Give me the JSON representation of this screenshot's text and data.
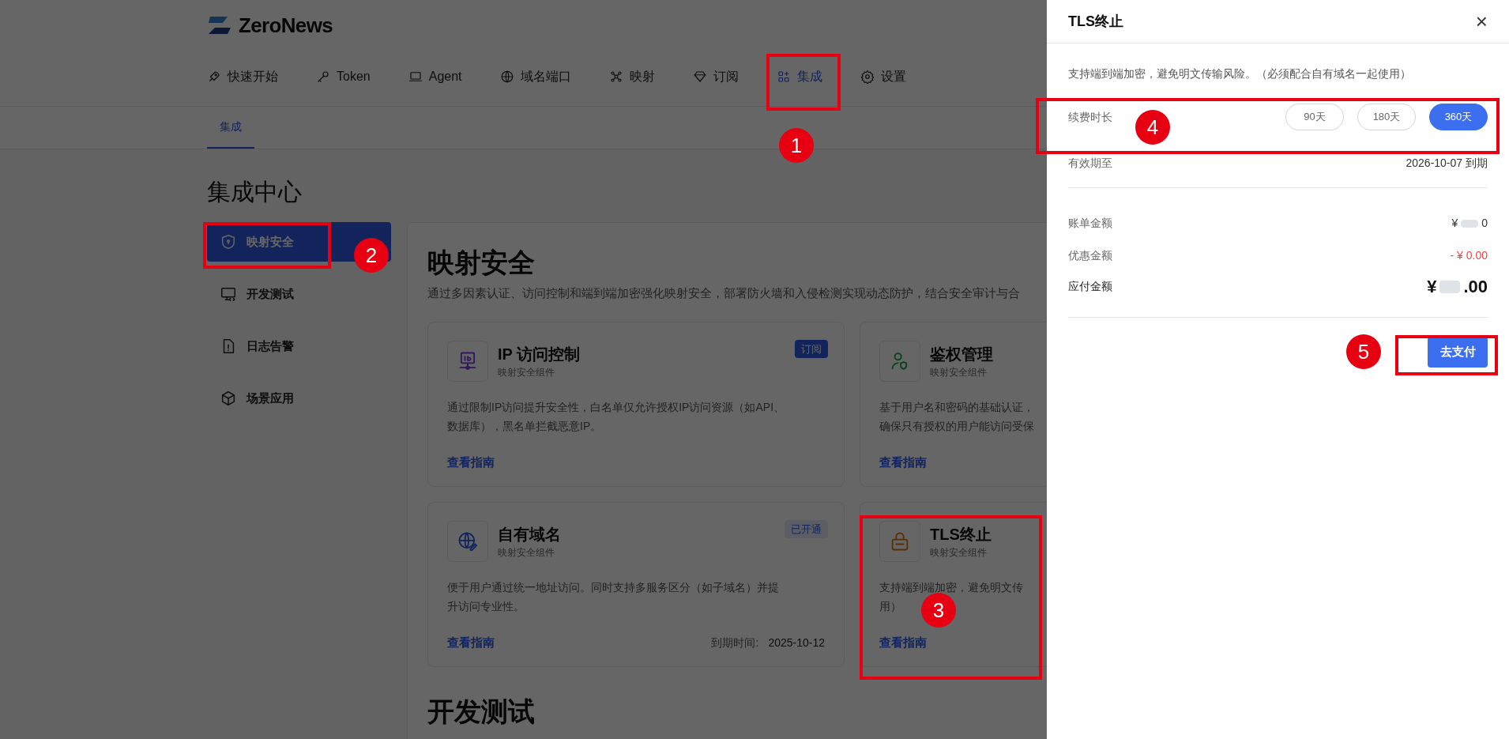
{
  "brand": {
    "name": "ZeroNews"
  },
  "nav": [
    {
      "label": "快速开始",
      "selected": false
    },
    {
      "label": "Token",
      "selected": false
    },
    {
      "label": "Agent",
      "selected": false
    },
    {
      "label": "域名端口",
      "selected": false
    },
    {
      "label": "映射",
      "selected": false
    },
    {
      "label": "订阅",
      "selected": false
    },
    {
      "label": "集成",
      "selected": true
    },
    {
      "label": "设置",
      "selected": false
    }
  ],
  "subtabs": [
    {
      "label": "集成",
      "selected": true
    }
  ],
  "page_title": "集成中心",
  "sidebar": {
    "items": [
      {
        "label": "映射安全",
        "selected": true
      },
      {
        "label": "开发测试",
        "selected": false
      },
      {
        "label": "日志告警",
        "selected": false
      },
      {
        "label": "场景应用",
        "selected": false
      }
    ]
  },
  "section": {
    "title": "映射安全",
    "description": "通过多因素认证、访问控制和端到端加密强化映射安全，部署防火墙和入侵检测实现动态防护，结合安全审计与合",
    "cards": [
      {
        "title": "IP 访问控制",
        "subtitle": "映射安全组件",
        "badge": {
          "kind": "subscribe",
          "label": "订阅"
        },
        "description_lines": [
          "通过限制IP访问提升安全性，白名单仅允许授权IP访问资源（如API、",
          "数据库），黑名单拦截恶意IP。"
        ],
        "link": "查看指南"
      },
      {
        "title": "鉴权管理",
        "subtitle": "映射安全组件",
        "description_lines": [
          "基于用户名和密码的基础认证，",
          "确保只有授权的用户能访问受保"
        ],
        "link": "查看指南"
      },
      {
        "title": "自有域名",
        "subtitle": "映射安全组件",
        "badge": {
          "kind": "active",
          "label": "已开通"
        },
        "description_lines": [
          "便于用户通过统一地址访问。同时支持多服务区分（如子域名）并提",
          "升访问专业性。"
        ],
        "link": "查看指南",
        "expiry_label": "到期时间:",
        "expiry_value": "2025-10-12"
      },
      {
        "title": "TLS终止",
        "subtitle": "映射安全组件",
        "description_lines": [
          "支持端到端加密，避免明文传",
          "用）"
        ],
        "link": "查看指南"
      }
    ]
  },
  "next_section": {
    "title": "开发测试"
  },
  "drawer": {
    "title": "TLS终止",
    "close": "×",
    "description": "支持端到端加密，避免明文传输风险。（必须配合自有域名一起使用）",
    "duration": {
      "label": "续费时长",
      "options": [
        {
          "label": "90天",
          "selected": false
        },
        {
          "label": "180天",
          "selected": false
        },
        {
          "label": "360天",
          "selected": true
        }
      ]
    },
    "valid_until": {
      "label": "有效期至",
      "value": "2026-10-07 到期"
    },
    "bill": {
      "label": "账单金额",
      "prefix": "¥",
      "suffix": "0"
    },
    "discount": {
      "label": "优惠金额",
      "value": "- ¥ 0.00"
    },
    "total": {
      "label": "应付金额",
      "prefix": "¥",
      "suffix": ".00"
    },
    "pay_button": "去支付"
  },
  "annotations": [
    {
      "number": "1"
    },
    {
      "number": "2"
    },
    {
      "number": "3"
    },
    {
      "number": "4"
    },
    {
      "number": "5"
    }
  ]
}
